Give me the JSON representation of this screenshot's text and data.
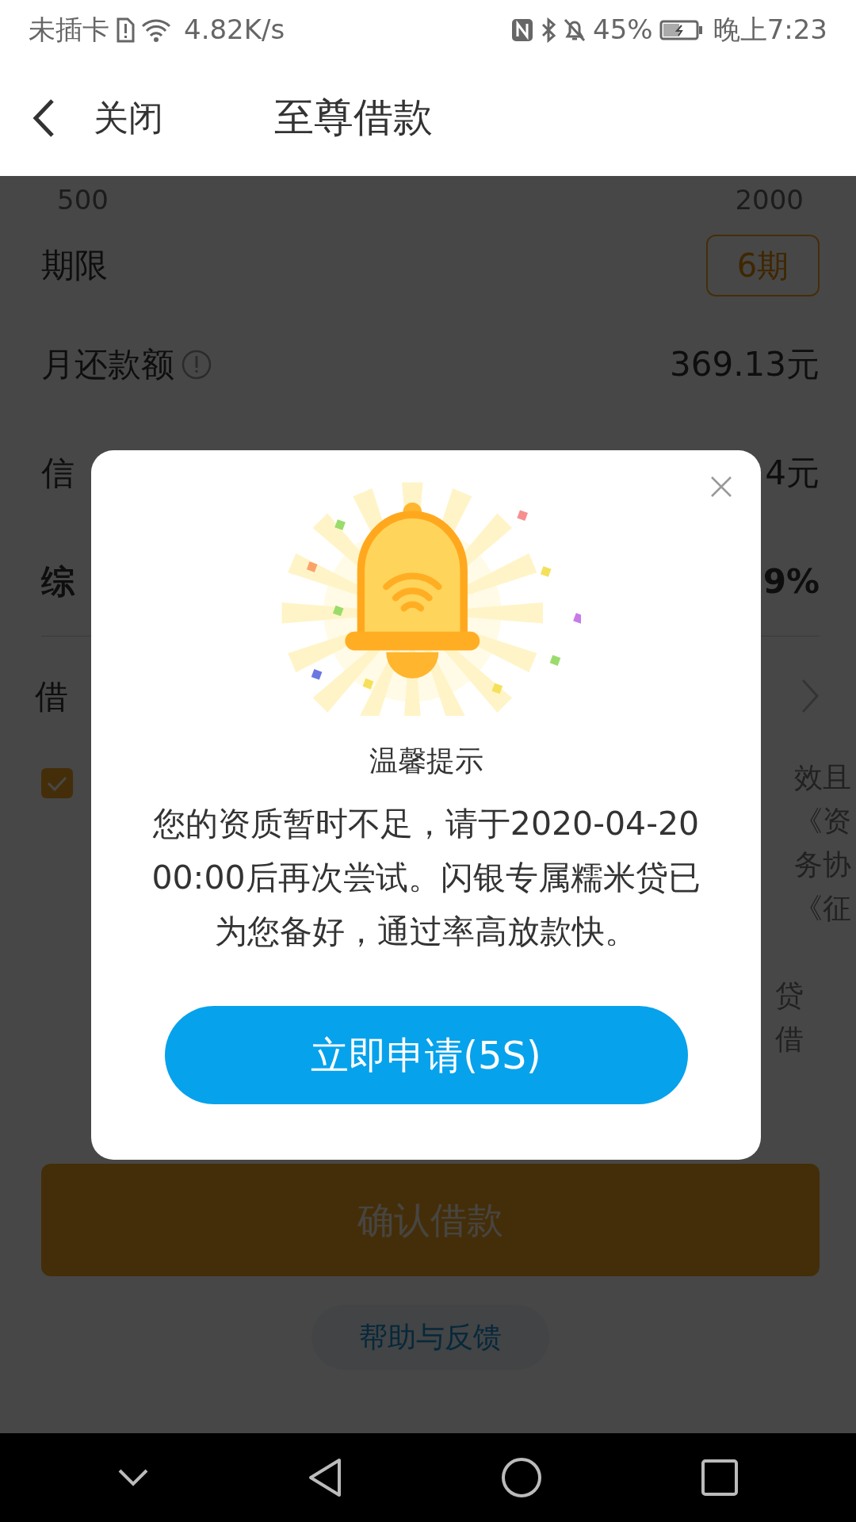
{
  "status_bar": {
    "carrier": "未插卡",
    "speed": "4.82K/s",
    "battery": "45%",
    "time": "晚上7:23"
  },
  "header": {
    "back_label": "关闭",
    "title": "至尊借款"
  },
  "background": {
    "slider_min": "500",
    "slider_max": "2000",
    "term_label": "期限",
    "term_value": "6期",
    "rows": [
      {
        "label": "月还款额",
        "value": "369.13元",
        "kind": "info"
      },
      {
        "label": "信",
        "value": "4元",
        "kind": "plain"
      },
      {
        "label": "综",
        "value": "9%",
        "kind": "bold"
      }
    ],
    "link_row": "借",
    "agreement_checked": true,
    "agreement_fragments": [
      "效且",
      "《资",
      "务协",
      "《征"
    ],
    "notice_fragments": [
      "贷",
      "借"
    ],
    "confirm_button": "确认借款",
    "help_link": "帮助与反馈"
  },
  "dialog": {
    "title": "温馨提示",
    "message": "您的资质暂时不足，请于2020-04-20 00:00后再次尝试。闪银专属糯米贷已为您备好，通过率高放款快。",
    "button": "立即申请(5S)"
  }
}
